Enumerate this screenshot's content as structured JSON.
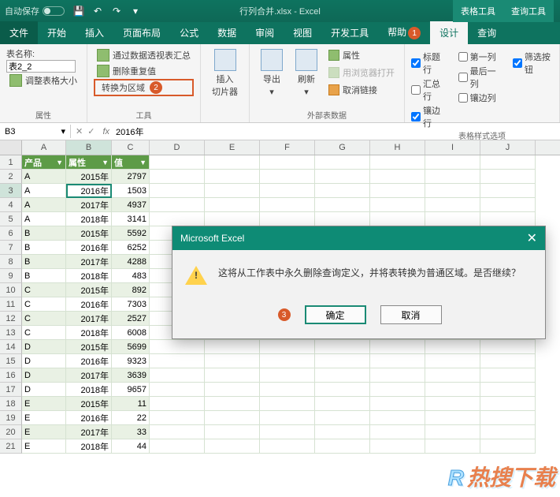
{
  "titlebar": {
    "autosave": "自动保存",
    "doc_title": "行列合并.xlsx - Excel",
    "context_tabs": [
      "表格工具",
      "查询工具"
    ]
  },
  "tabs": {
    "file": "文件",
    "home": "开始",
    "insert": "插入",
    "layout": "页面布局",
    "formulas": "公式",
    "data": "数据",
    "review": "审阅",
    "view": "视图",
    "dev": "开发工具",
    "help": "帮助",
    "design": "设计",
    "query": "查询"
  },
  "ribbon": {
    "name_label": "表名称:",
    "name_value": "表2_2",
    "resize": "调整表格大小",
    "group_props": "属性",
    "pivot": "通过数据透视表汇总",
    "dedupe": "删除重复值",
    "convert": "转换为区域",
    "group_tools": "工具",
    "slicer": "插入\n切片器",
    "export": "导出",
    "refresh": "刷新",
    "ext_props": "属性",
    "browser": "用浏览器打开",
    "unlink": "取消链接",
    "group_ext": "外部表数据",
    "header_row": "标题行",
    "total_row": "汇总行",
    "banded_row": "镶边行",
    "first_col": "第一列",
    "last_col": "最后一列",
    "banded_col": "镶边列",
    "filter_btn": "筛选按钮",
    "group_style": "表格样式选项"
  },
  "badges": {
    "help": "1",
    "convert": "2",
    "ok": "3"
  },
  "formula": {
    "namebox": "B3",
    "value": "2016年"
  },
  "sheet": {
    "columns": [
      "A",
      "B",
      "C",
      "D",
      "E",
      "F",
      "G",
      "H",
      "I",
      "J"
    ],
    "headers": {
      "a": "产品",
      "b": "属性",
      "c": "值"
    },
    "selected_row": 3,
    "selected_col": "B",
    "rows": [
      {
        "n": 2,
        "a": "A",
        "b": "2015年",
        "c": "2797"
      },
      {
        "n": 3,
        "a": "A",
        "b": "2016年",
        "c": "1503"
      },
      {
        "n": 4,
        "a": "A",
        "b": "2017年",
        "c": "4937"
      },
      {
        "n": 5,
        "a": "A",
        "b": "2018年",
        "c": "3141"
      },
      {
        "n": 6,
        "a": "B",
        "b": "2015年",
        "c": "5592"
      },
      {
        "n": 7,
        "a": "B",
        "b": "2016年",
        "c": "6252"
      },
      {
        "n": 8,
        "a": "B",
        "b": "2017年",
        "c": "4288"
      },
      {
        "n": 9,
        "a": "B",
        "b": "2018年",
        "c": "483"
      },
      {
        "n": 10,
        "a": "C",
        "b": "2015年",
        "c": "892"
      },
      {
        "n": 11,
        "a": "C",
        "b": "2016年",
        "c": "7303"
      },
      {
        "n": 12,
        "a": "C",
        "b": "2017年",
        "c": "2527"
      },
      {
        "n": 13,
        "a": "C",
        "b": "2018年",
        "c": "6008"
      },
      {
        "n": 14,
        "a": "D",
        "b": "2015年",
        "c": "5699"
      },
      {
        "n": 15,
        "a": "D",
        "b": "2016年",
        "c": "9323"
      },
      {
        "n": 16,
        "a": "D",
        "b": "2017年",
        "c": "3639"
      },
      {
        "n": 17,
        "a": "D",
        "b": "2018年",
        "c": "9657"
      },
      {
        "n": 18,
        "a": "E",
        "b": "2015年",
        "c": "11"
      },
      {
        "n": 19,
        "a": "E",
        "b": "2016年",
        "c": "22"
      },
      {
        "n": 20,
        "a": "E",
        "b": "2017年",
        "c": "33"
      },
      {
        "n": 21,
        "a": "E",
        "b": "2018年",
        "c": "44"
      }
    ]
  },
  "dialog": {
    "title": "Microsoft Excel",
    "message": "这将从工作表中永久删除查询定义，并将表转换为普通区域。是否继续？",
    "ok": "确定",
    "cancel": "取消"
  },
  "watermark": "热搜下载"
}
